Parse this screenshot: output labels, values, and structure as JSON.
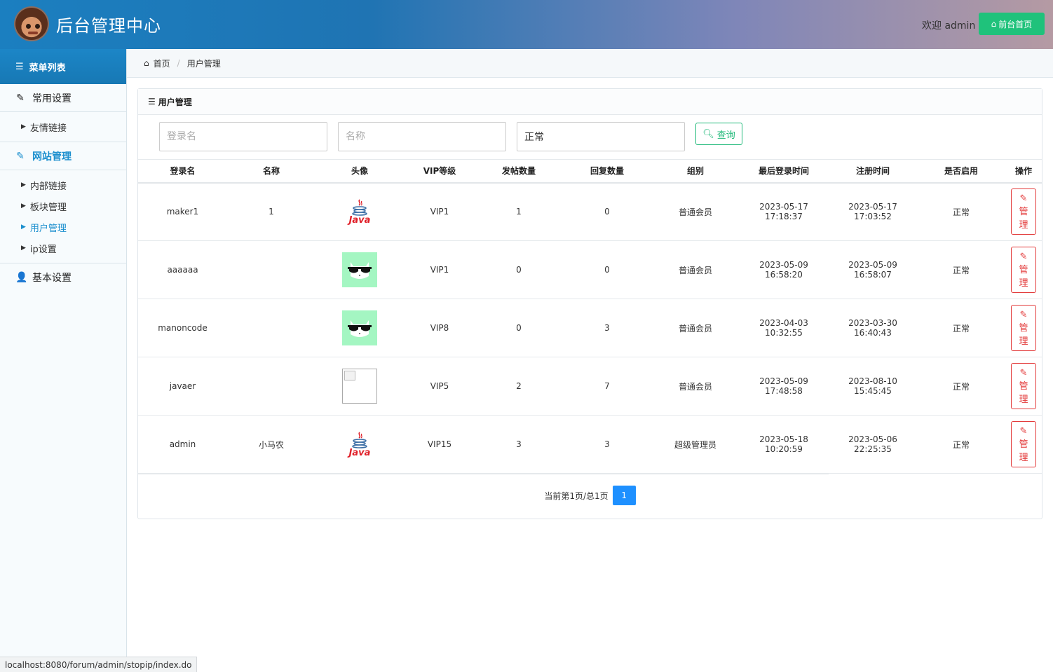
{
  "header": {
    "title": "后台管理中心",
    "welcome": "欢迎 admin",
    "home_button": "前台首页",
    "colors": {
      "brand": "#1b7fc0",
      "success": "#1fc27b"
    }
  },
  "sidebar": {
    "menu_title": "菜单列表",
    "groups": [
      {
        "label": "常用设置",
        "icon": "edit-icon",
        "items": [
          "友情链接"
        ]
      },
      {
        "label": "网站管理",
        "icon": "edit-icon",
        "active": true,
        "items": [
          "内部链接",
          "板块管理",
          "用户管理",
          "ip设置"
        ],
        "active_item": "用户管理"
      },
      {
        "label": "基本设置",
        "icon": "user-icon",
        "items": []
      }
    ]
  },
  "breadcrumb": {
    "home": "首页",
    "current": "用户管理"
  },
  "panel": {
    "title": "用户管理",
    "filters": {
      "login_placeholder": "登录名",
      "name_placeholder": "名称",
      "status_value": "正常",
      "search_label": "查询"
    },
    "table": {
      "columns": [
        "登录名",
        "名称",
        "头像",
        "VIP等级",
        "发帖数量",
        "回复数量",
        "组别",
        "最后登录时间",
        "注册时间",
        "是否启用",
        "操作"
      ],
      "rows": [
        {
          "login": "maker1",
          "name": "1",
          "avatar": "java",
          "vip": "VIP1",
          "posts": "1",
          "replies": "0",
          "group": "普通会员",
          "last_login_date": "2023-05-17",
          "last_login_time": "17:18:37",
          "reg_date": "2023-05-17",
          "reg_time": "17:03:52",
          "status": "正常"
        },
        {
          "login": "aaaaaa",
          "name": "",
          "avatar": "cool",
          "vip": "VIP1",
          "posts": "0",
          "replies": "0",
          "group": "普通会员",
          "last_login_date": "2023-05-09",
          "last_login_time": "16:58:20",
          "reg_date": "2023-05-09",
          "reg_time": "16:58:07",
          "status": "正常"
        },
        {
          "login": "manoncode",
          "name": "",
          "avatar": "cool",
          "vip": "VIP8",
          "posts": "0",
          "replies": "3",
          "group": "普通会员",
          "last_login_date": "2023-04-03",
          "last_login_time": "10:32:55",
          "reg_date": "2023-03-30",
          "reg_time": "16:40:43",
          "status": "正常"
        },
        {
          "login": "javaer",
          "name": "",
          "avatar": "broken",
          "vip": "VIP5",
          "posts": "2",
          "replies": "7",
          "group": "普通会员",
          "last_login_date": "2023-05-09",
          "last_login_time": "17:48:58",
          "reg_date": "2023-08-10",
          "reg_time": "15:45:45",
          "status": "正常"
        },
        {
          "login": "admin",
          "name": "小马农",
          "avatar": "java",
          "vip": "VIP15",
          "posts": "3",
          "replies": "3",
          "group": "超级管理员",
          "last_login_date": "2023-05-18",
          "last_login_time": "10:20:59",
          "reg_date": "2023-05-06",
          "reg_time": "22:25:35",
          "status": "正常"
        }
      ],
      "manage_label_1": "管",
      "manage_label_2": "理"
    },
    "pager": {
      "summary": "当前第1页/总1页",
      "current_page": "1"
    }
  },
  "statusbar": {
    "url": "localhost:8080/forum/admin/stopip/index.do"
  }
}
